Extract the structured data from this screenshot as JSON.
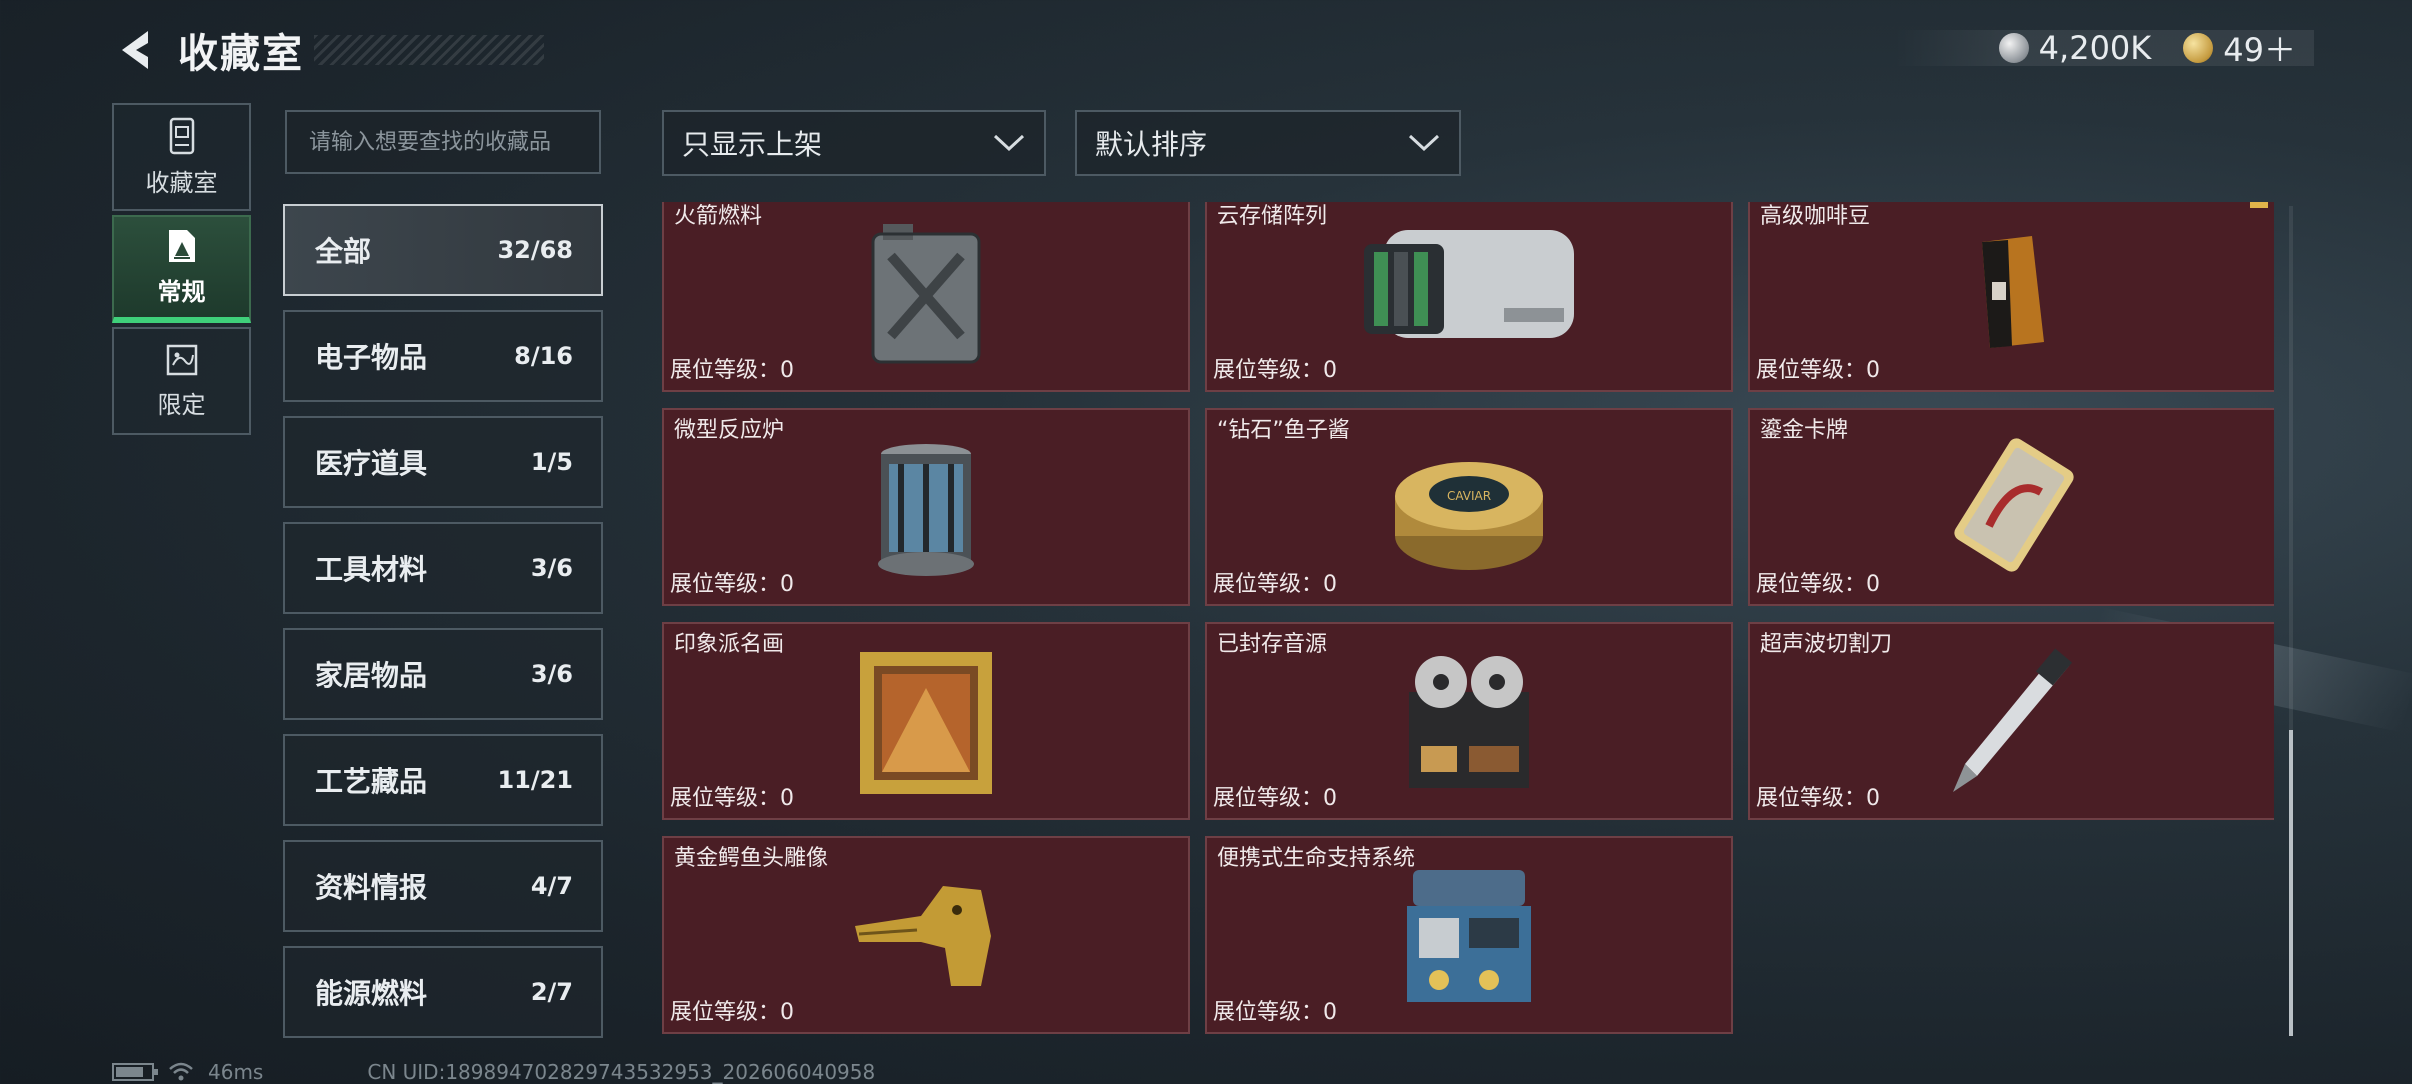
{
  "header": {
    "title": "收藏室"
  },
  "currency": [
    {
      "icon": "silver-coin-icon",
      "value": "4,200K"
    },
    {
      "icon": "gold-coin-icon",
      "value": "49＋"
    }
  ],
  "left_nav": [
    {
      "label": "收藏室",
      "icon": "cabinet-icon",
      "active": false
    },
    {
      "label": "常规",
      "icon": "document-icon",
      "active": true
    },
    {
      "label": "限定",
      "icon": "map-icon",
      "active": false
    }
  ],
  "search": {
    "placeholder": "请输入想要查找的收藏品",
    "value": ""
  },
  "categories": [
    {
      "name": "全部",
      "count": "32/68",
      "active": true
    },
    {
      "name": "电子物品",
      "count": "8/16"
    },
    {
      "name": "医疗道具",
      "count": "1/5"
    },
    {
      "name": "工具材料",
      "count": "3/6"
    },
    {
      "name": "家居物品",
      "count": "3/6"
    },
    {
      "name": "工艺藏品",
      "count": "11/21"
    },
    {
      "name": "资料情报",
      "count": "4/7"
    },
    {
      "name": "能源燃料",
      "count": "2/7"
    }
  ],
  "filters": {
    "shelf": "只显示上架",
    "sort": "默认排序"
  },
  "items": [
    {
      "name": "火箭燃料",
      "level": "展位等级：0",
      "icon": "fuel-can-icon"
    },
    {
      "name": "云存储阵列",
      "level": "展位等级：0",
      "icon": "server-array-icon"
    },
    {
      "name": "高级咖啡豆",
      "level": "展位等级：0",
      "icon": "coffee-bag-icon"
    },
    {
      "name": "微型反应炉",
      "level": "展位等级：0",
      "icon": "reactor-icon"
    },
    {
      "name": "“钻石”鱼子酱",
      "level": "展位等级：0",
      "icon": "caviar-tin-icon"
    },
    {
      "name": "鎏金卡牌",
      "level": "展位等级：0",
      "icon": "gold-card-icon"
    },
    {
      "name": "印象派名画",
      "level": "展位等级：0",
      "icon": "painting-icon"
    },
    {
      "name": "已封存音源",
      "level": "展位等级：0",
      "icon": "reel-recorder-icon"
    },
    {
      "name": "超声波切割刀",
      "level": "展位等级：0",
      "icon": "cutter-knife-icon"
    },
    {
      "name": "黄金鳄鱼头雕像",
      "level": "展位等级：0",
      "icon": "croc-statue-icon"
    },
    {
      "name": "便携式生命支持系统",
      "level": "展位等级：0",
      "icon": "life-support-icon"
    }
  ],
  "status": {
    "ping": "46ms",
    "uid": "CN UID:189894702829743532953_202606040958",
    "battery_level": 0.8
  }
}
